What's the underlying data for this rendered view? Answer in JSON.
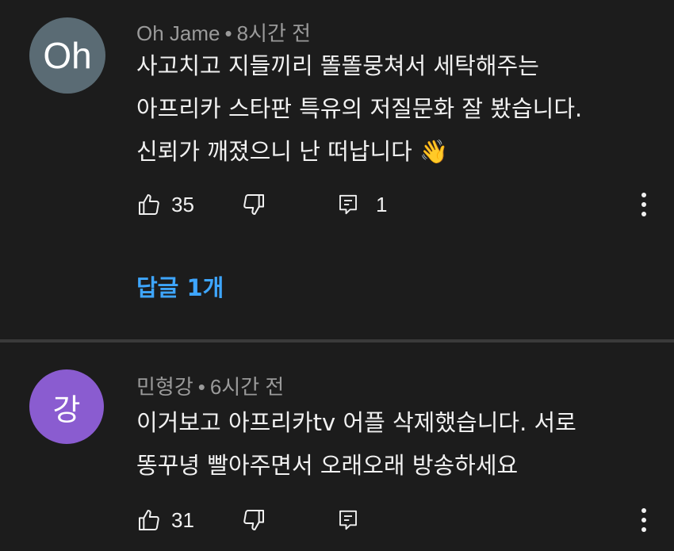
{
  "comments": [
    {
      "avatar_text": "Oh",
      "author": "Oh Jame",
      "separator": "•",
      "time": "8시간 전",
      "lines": [
        "사고치고 지들끼리 똘똘뭉쳐서 세탁해주는",
        "아프리카 스타판 특유의 저질문화 잘 봤습니다.",
        "신뢰가 깨졌으니 난 떠납니다 👋"
      ],
      "likes": "35",
      "reply_count": "1",
      "replies_link": "답글 1개",
      "avatar_color": "#5a6b74"
    },
    {
      "avatar_text": "강",
      "author": "민형강",
      "separator": "•",
      "time": "6시간 전",
      "lines": [
        "이거보고 아프리카tv 어플 삭제했습니다. 서로",
        "똥꾸녕 빨아주면서 오래오래 방송하세요"
      ],
      "likes": "31",
      "avatar_color": "#8a5cd0"
    }
  ],
  "colors": {
    "background": "#1c1c1c",
    "link": "#3ea6ff",
    "meta_text": "#9a9a9a",
    "divider": "#3a3a3a"
  },
  "icons": {
    "like": "thumbs-up-icon",
    "dislike": "thumbs-down-icon",
    "reply": "comment-reply-icon",
    "more": "more-vertical-icon"
  }
}
